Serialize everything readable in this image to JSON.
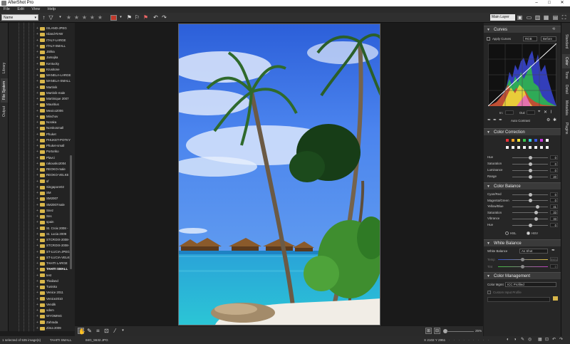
{
  "app": {
    "title": "AfterShot Pro"
  },
  "window_controls": {
    "minimize": "–",
    "maximize": "□",
    "close": "✕"
  },
  "menu": [
    "File",
    "Edit",
    "View",
    "Help"
  ],
  "toolbar": {
    "sort_value": "Name",
    "layer_value": "Main Layer",
    "rating_stars": 5,
    "color_label": "#c0392b"
  },
  "left_tabs": [
    "Library",
    "File System",
    "Output"
  ],
  "folders": [
    "ISLAND-JPEG",
    "Island-RAW",
    "ITALY-LARGE",
    "ITALY-SMALL",
    "Jähka",
    "Jamajka",
    "Kentucky",
    "Krusitone",
    "MANELA-LARGE",
    "MANELA-SMALL",
    "Martinik",
    "Martinik-male",
    "Martinique 2007",
    "Mauritius",
    "Mexico2006",
    "Minchov",
    "Noraka",
    "Norskosmall",
    "Phuket",
    "PHUKET-POTKY",
    "Phuket-small",
    "Portoriko",
    "Plavci",
    "rakousko2004",
    "REOKO-male",
    "REOKO-VELKE",
    "sf",
    "Singapore02",
    "SM",
    "SM2007",
    "SM2007male",
    "Snez",
    "Sns",
    "spain",
    "St. Croix 2008 -",
    "St. Lucia 2009",
    "STCROIX-2008-",
    "STCROIX-2008-",
    "ST-LUCIA-JPEG",
    "ST-LUCIA-VELKE",
    "TAHITI LARGE",
    "TAHITI SMALL",
    "test",
    "Thailand",
    "Tunisko",
    "Venice 2011",
    "Venice2010",
    "Vendik",
    "vdem",
    "WYOMING",
    "Zahrada",
    "Zima 2009",
    "Zkusim"
  ],
  "selected_folder": "TAHITI SMALL",
  "status": {
    "selection": "1 selected of 535 image(s)",
    "folder": "TAHITI SMALL",
    "file": "IMG_5532.JPG",
    "coords": "X 2102 Y 2951",
    "zoom": "25%"
  },
  "right_tabs": [
    "Standard",
    "Color",
    "Tone",
    "Detail",
    "Metadata",
    "Plugins"
  ],
  "curves": {
    "title": "Curves",
    "apply_label": "Apply Curves",
    "channel": "RGB",
    "mode": "Before",
    "in_label": "In:",
    "out_label": "Out:",
    "auto_contrast": "Auto Contrast"
  },
  "color_correction": {
    "title": "Color Correction",
    "swatches": [
      "#e8333a",
      "#f2a22a",
      "#f3e53b",
      "#37c24b",
      "#3cc8d8",
      "#3a56e0",
      "#c93ad9",
      "#ffffff"
    ],
    "sliders": [
      {
        "label": "Hue",
        "value": "0"
      },
      {
        "label": "Saturation",
        "value": "0"
      },
      {
        "label": "Luminance",
        "value": "0"
      },
      {
        "label": "Range",
        "value": "20"
      }
    ]
  },
  "color_balance": {
    "title": "Color Balance",
    "sliders": [
      {
        "label": "Cyan/Red",
        "value": "0"
      },
      {
        "label": "Magenta/Green",
        "value": "0"
      },
      {
        "label": "Yellow/Blue",
        "value": "41"
      },
      {
        "label": "Saturation",
        "value": "33"
      },
      {
        "label": "Vibrance",
        "value": "33"
      },
      {
        "label": "Hue",
        "value": "0"
      }
    ],
    "hsl_label": "HSL",
    "hsv_label": "HSV"
  },
  "white_balance": {
    "title": "White Balance",
    "label": "White Balance",
    "value": "As Shot",
    "temp_label": "Temp",
    "temp_value": "5501",
    "tint_label": "Tint",
    "tint_value": "0"
  },
  "color_management": {
    "title": "Color Management",
    "label": "Color Mgmt",
    "value": "ICC Profiled",
    "custom_label": "Custom Input Profile"
  }
}
